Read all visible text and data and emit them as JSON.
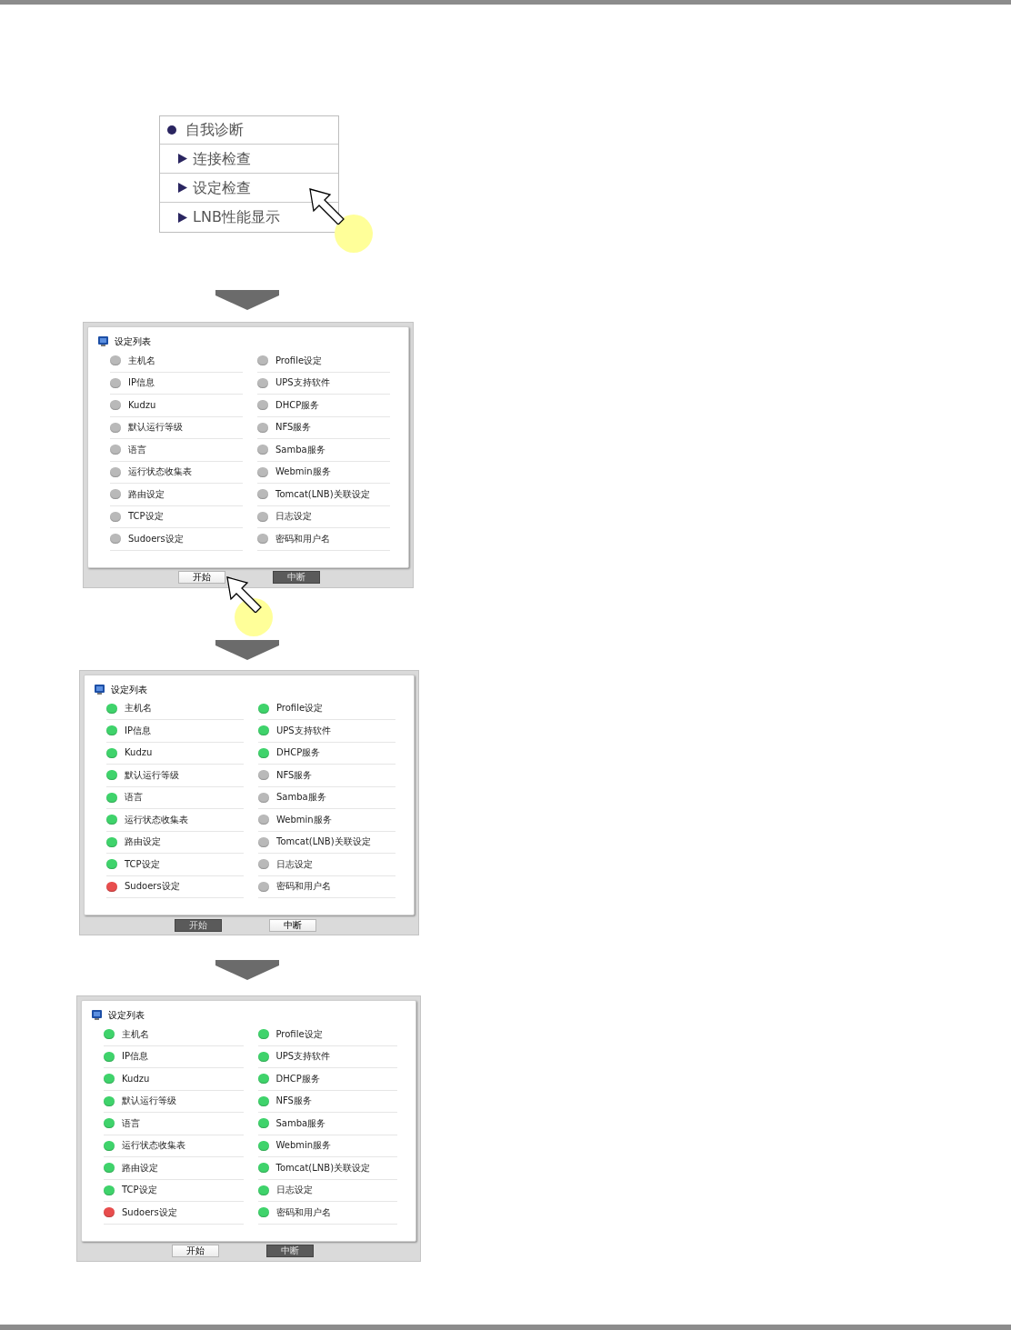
{
  "menu": {
    "header": "自我诊断",
    "items": [
      {
        "label": "连接检查"
      },
      {
        "label": "设定检查"
      },
      {
        "label": "LNB性能显示"
      }
    ]
  },
  "panels": [
    {
      "title": "设定列表",
      "columns": [
        [
          {
            "label": "主机名",
            "color": "#b9b9b9"
          },
          {
            "label": "IP信息",
            "color": "#b9b9b9"
          },
          {
            "label": "Kudzu",
            "color": "#b9b9b9"
          },
          {
            "label": "默认运行等级",
            "color": "#b9b9b9"
          },
          {
            "label": "语言",
            "color": "#b9b9b9"
          },
          {
            "label": "运行状态收集表",
            "color": "#b9b9b9"
          },
          {
            "label": "路由设定",
            "color": "#b9b9b9"
          },
          {
            "label": "TCP设定",
            "color": "#b9b9b9"
          },
          {
            "label": "Sudoers设定",
            "color": "#b9b9b9"
          }
        ],
        [
          {
            "label": "Profile设定",
            "color": "#b9b9b9"
          },
          {
            "label": "UPS支持软件",
            "color": "#b9b9b9"
          },
          {
            "label": "DHCP服务",
            "color": "#b9b9b9"
          },
          {
            "label": "NFS服务",
            "color": "#b9b9b9"
          },
          {
            "label": "Samba服务",
            "color": "#b9b9b9"
          },
          {
            "label": "Webmin服务",
            "color": "#b9b9b9"
          },
          {
            "label": "Tomcat(LNB)关联设定",
            "color": "#b9b9b9"
          },
          {
            "label": "日志设定",
            "color": "#b9b9b9"
          },
          {
            "label": "密码和用户名",
            "color": "#b9b9b9"
          }
        ]
      ],
      "buttons": [
        {
          "label": "开始",
          "disabled": false
        },
        {
          "label": "中断",
          "disabled": true
        }
      ]
    },
    {
      "title": "设定列表",
      "columns": [
        [
          {
            "label": "主机名",
            "color": "#3fd36b"
          },
          {
            "label": "IP信息",
            "color": "#3fd36b"
          },
          {
            "label": "Kudzu",
            "color": "#3fd36b"
          },
          {
            "label": "默认运行等级",
            "color": "#3fd36b"
          },
          {
            "label": "语言",
            "color": "#3fd36b"
          },
          {
            "label": "运行状态收集表",
            "color": "#3fd36b"
          },
          {
            "label": "路由设定",
            "color": "#3fd36b"
          },
          {
            "label": "TCP设定",
            "color": "#3fd36b"
          },
          {
            "label": "Sudoers设定",
            "color": "#e84d4d"
          }
        ],
        [
          {
            "label": "Profile设定",
            "color": "#3fd36b"
          },
          {
            "label": "UPS支持软件",
            "color": "#3fd36b"
          },
          {
            "label": "DHCP服务",
            "color": "#3fd36b"
          },
          {
            "label": "NFS服务",
            "color": "#b9b9b9"
          },
          {
            "label": "Samba服务",
            "color": "#b9b9b9"
          },
          {
            "label": "Webmin服务",
            "color": "#b9b9b9"
          },
          {
            "label": "Tomcat(LNB)关联设定",
            "color": "#b9b9b9"
          },
          {
            "label": "日志设定",
            "color": "#b9b9b9"
          },
          {
            "label": "密码和用户名",
            "color": "#b9b9b9"
          }
        ]
      ],
      "buttons": [
        {
          "label": "开始",
          "disabled": true
        },
        {
          "label": "中断",
          "disabled": false
        }
      ]
    },
    {
      "title": "设定列表",
      "columns": [
        [
          {
            "label": "主机名",
            "color": "#3fd36b"
          },
          {
            "label": "IP信息",
            "color": "#3fd36b"
          },
          {
            "label": "Kudzu",
            "color": "#3fd36b"
          },
          {
            "label": "默认运行等级",
            "color": "#3fd36b"
          },
          {
            "label": "语言",
            "color": "#3fd36b"
          },
          {
            "label": "运行状态收集表",
            "color": "#3fd36b"
          },
          {
            "label": "路由设定",
            "color": "#3fd36b"
          },
          {
            "label": "TCP设定",
            "color": "#3fd36b"
          },
          {
            "label": "Sudoers设定",
            "color": "#e84d4d"
          }
        ],
        [
          {
            "label": "Profile设定",
            "color": "#3fd36b"
          },
          {
            "label": "UPS支持软件",
            "color": "#3fd36b"
          },
          {
            "label": "DHCP服务",
            "color": "#3fd36b"
          },
          {
            "label": "NFS服务",
            "color": "#3fd36b"
          },
          {
            "label": "Samba服务",
            "color": "#3fd36b"
          },
          {
            "label": "Webmin服务",
            "color": "#3fd36b"
          },
          {
            "label": "Tomcat(LNB)关联设定",
            "color": "#3fd36b"
          },
          {
            "label": "日志设定",
            "color": "#3fd36b"
          },
          {
            "label": "密码和用户名",
            "color": "#3fd36b"
          }
        ]
      ],
      "buttons": [
        {
          "label": "开始",
          "disabled": false
        },
        {
          "label": "中断",
          "disabled": true
        }
      ]
    }
  ]
}
